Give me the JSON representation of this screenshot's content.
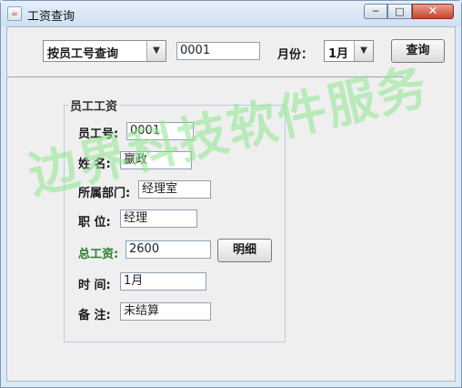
{
  "window": {
    "title": "工资查询",
    "min": "─",
    "max": "□",
    "close": "✕"
  },
  "toolbar": {
    "query_type": "按员工号查询",
    "query_input": "0001",
    "month_label": "月份：",
    "month_value": "1月",
    "query_button": "查询"
  },
  "group": {
    "legend": "员工工资",
    "fields": {
      "emp_no": {
        "label": "员工号:",
        "value": "0001"
      },
      "name": {
        "label": "姓  名:",
        "value": "嬴政"
      },
      "dept": {
        "label": "所属部门:",
        "value": "经理室"
      },
      "position": {
        "label": "职  位:",
        "value": "经理"
      },
      "total": {
        "label": "总工资:",
        "value": "2600"
      },
      "time": {
        "label": "时  间:",
        "value": "1月"
      },
      "remark": {
        "label": "备  注:",
        "value": "未结算"
      }
    },
    "detail_button": "明细"
  },
  "watermark": "边界科技软件服务"
}
